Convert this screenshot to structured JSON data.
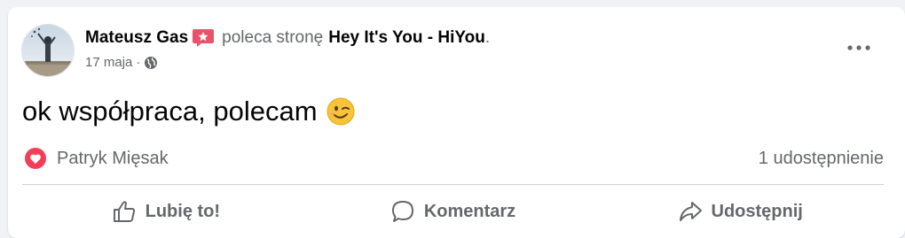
{
  "post": {
    "author": "Mateusz Gas",
    "verb": "poleca stronę",
    "page_name": "Hey It's You - HiYou",
    "page_suffix": ".",
    "date": "17 maja",
    "date_sep": "·",
    "audience_icon": "globe-icon",
    "more_icon": "more-options-icon",
    "text": "ok współpraca, polecam",
    "emoji": "winking-face-emoji"
  },
  "reactions": {
    "icon": "love-reaction-icon",
    "names": "Patryk Mięsak",
    "shares": "1 udostępnienie"
  },
  "actions": [
    {
      "label": "Lubię to!",
      "icon": "thumbs-up-icon"
    },
    {
      "label": "Komentarz",
      "icon": "comment-icon"
    },
    {
      "label": "Udostępnij",
      "icon": "share-icon"
    }
  ],
  "colors": {
    "background": "#f0f2f5",
    "card": "#ffffff",
    "secondary_text": "#65676b",
    "primary_text": "#050505",
    "badge": "#e9536a",
    "love": "#f33e58",
    "emoji": "#f7c33a"
  }
}
